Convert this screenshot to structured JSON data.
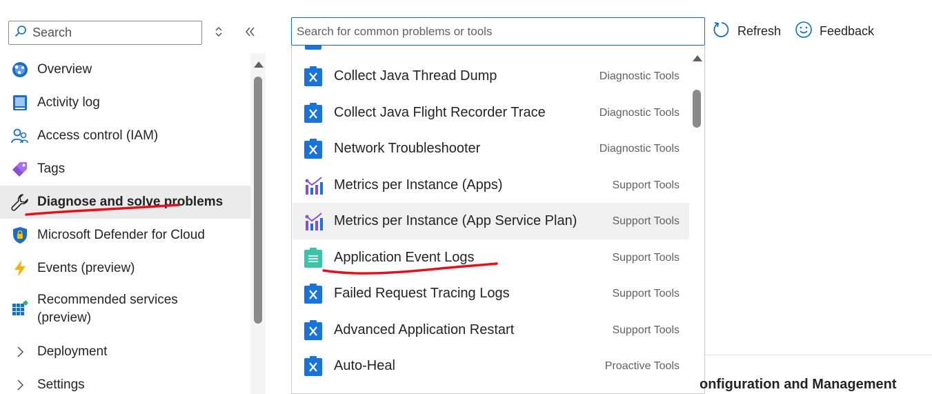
{
  "sidebar": {
    "search_label": "Search",
    "items": [
      {
        "label": "Overview",
        "icon": "overview-icon"
      },
      {
        "label": "Activity log",
        "icon": "activity-log-icon"
      },
      {
        "label": "Access control (IAM)",
        "icon": "access-control-icon"
      },
      {
        "label": "Tags",
        "icon": "tag-icon"
      },
      {
        "label": "Diagnose and solve problems",
        "icon": "wrench-icon",
        "active": true
      },
      {
        "label": "Microsoft Defender for Cloud",
        "icon": "shield-icon"
      },
      {
        "label": "Events (preview)",
        "icon": "lightning-icon"
      },
      {
        "label": "Recommended services",
        "label_line2": "(preview)",
        "icon": "grid-icon"
      },
      {
        "label": "Deployment",
        "icon": "chevron-right-icon"
      },
      {
        "label": "Settings",
        "icon": "chevron-right-icon"
      }
    ]
  },
  "toolbar": {
    "search_placeholder": "Search for common problems or tools",
    "refresh_label": "Refresh",
    "feedback_label": "Feedback"
  },
  "dropdown": {
    "items": [
      {
        "name": "Collect Java Thread Dump",
        "category": "Diagnostic Tools",
        "icon": "tool-icon"
      },
      {
        "name": "Collect Java Flight Recorder Trace",
        "category": "Diagnostic Tools",
        "icon": "tool-icon"
      },
      {
        "name": "Network Troubleshooter",
        "category": "Diagnostic Tools",
        "icon": "tool-icon"
      },
      {
        "name": "Metrics per Instance (Apps)",
        "category": "Support Tools",
        "icon": "metrics-icon"
      },
      {
        "name": "Metrics per Instance (App Service Plan)",
        "category": "Support Tools",
        "icon": "metrics-icon"
      },
      {
        "name": "Application Event Logs",
        "category": "Support Tools",
        "icon": "event-log-icon"
      },
      {
        "name": "Failed Request Tracing Logs",
        "category": "Support Tools",
        "icon": "tool-icon"
      },
      {
        "name": "Advanced Application Restart",
        "category": "Support Tools",
        "icon": "tool-icon"
      },
      {
        "name": "Auto-Heal",
        "category": "Proactive Tools",
        "icon": "tool-icon"
      }
    ]
  },
  "main": {
    "partial_heading": "onfiguration and Management"
  },
  "colors": {
    "accent": "#0f6cbd",
    "annotation_red": "#e3121a",
    "tool_icon_blue": "#1a73d9"
  }
}
